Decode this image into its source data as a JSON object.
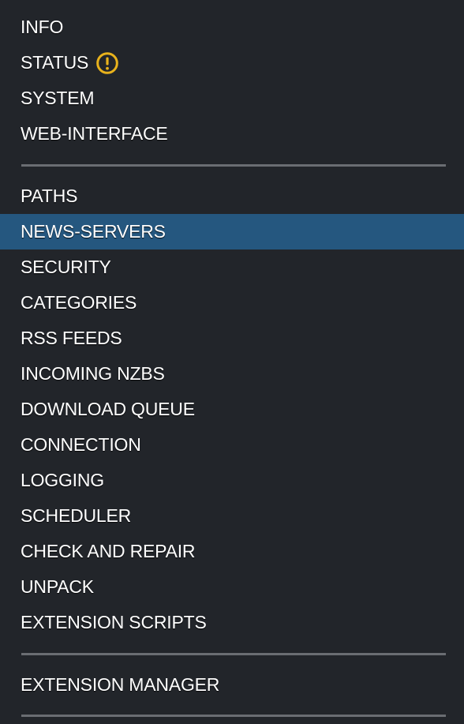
{
  "menu": {
    "group1": [
      {
        "label": "INFO"
      },
      {
        "label": "STATUS",
        "icon": "warning-icon",
        "icon_color": "#e8b21c"
      },
      {
        "label": "SYSTEM"
      },
      {
        "label": "WEB-INTERFACE"
      }
    ],
    "group2": [
      {
        "label": "PATHS"
      },
      {
        "label": "NEWS-SERVERS",
        "active": true
      },
      {
        "label": "SECURITY"
      },
      {
        "label": "CATEGORIES"
      },
      {
        "label": "RSS FEEDS"
      },
      {
        "label": "INCOMING NZBS"
      },
      {
        "label": "DOWNLOAD QUEUE"
      },
      {
        "label": "CONNECTION"
      },
      {
        "label": "LOGGING"
      },
      {
        "label": "SCHEDULER"
      },
      {
        "label": "CHECK AND REPAIR"
      },
      {
        "label": "UNPACK"
      },
      {
        "label": "EXTENSION SCRIPTS"
      }
    ],
    "group3": [
      {
        "label": "EXTENSION MANAGER"
      }
    ]
  },
  "colors": {
    "background": "#22252a",
    "active_background": "#25577f",
    "divider": "#6a6d72",
    "text": "#ffffff",
    "warning": "#e8b21c"
  }
}
